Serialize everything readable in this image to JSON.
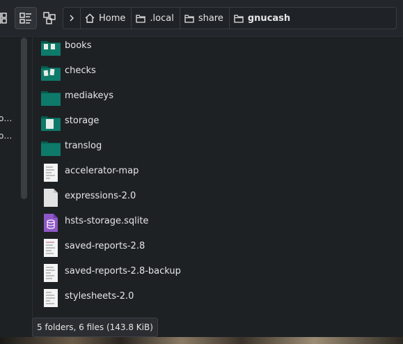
{
  "toolbar": {
    "icons_view_icon": "grid-view-icon",
    "details_view_icon": "details-view-icon",
    "split_view_icon": "split-view-icon"
  },
  "breadcrumb": {
    "items": [
      {
        "label": "Home",
        "icon": "home-icon"
      },
      {
        "label": ".local",
        "icon": "folder-icon"
      },
      {
        "label": "share",
        "icon": "folder-icon"
      },
      {
        "label": "gnucash",
        "icon": "folder-icon"
      }
    ]
  },
  "sidebar": {
    "items": [
      {
        "label": "o…"
      },
      {
        "label": "o…"
      }
    ]
  },
  "files": [
    {
      "name": "books",
      "type": "folder"
    },
    {
      "name": "checks",
      "type": "folder"
    },
    {
      "name": "mediakeys",
      "type": "folder"
    },
    {
      "name": "storage",
      "type": "folder"
    },
    {
      "name": "translog",
      "type": "folder"
    },
    {
      "name": "accelerator-map",
      "type": "text"
    },
    {
      "name": "expressions-2.0",
      "type": "blank"
    },
    {
      "name": "hsts-storage.sqlite",
      "type": "sqlite"
    },
    {
      "name": "saved-reports-2.8",
      "type": "text"
    },
    {
      "name": "saved-reports-2.8-backup",
      "type": "text"
    },
    {
      "name": "stylesheets-2.0",
      "type": "text"
    }
  ],
  "status": "5 folders, 6 files (143.8 KiB)",
  "colors": {
    "folder": "#0e7a6a",
    "folder_dark": "#075a4e",
    "accent": "#3daee9",
    "sqlite": "#8e57c7"
  }
}
